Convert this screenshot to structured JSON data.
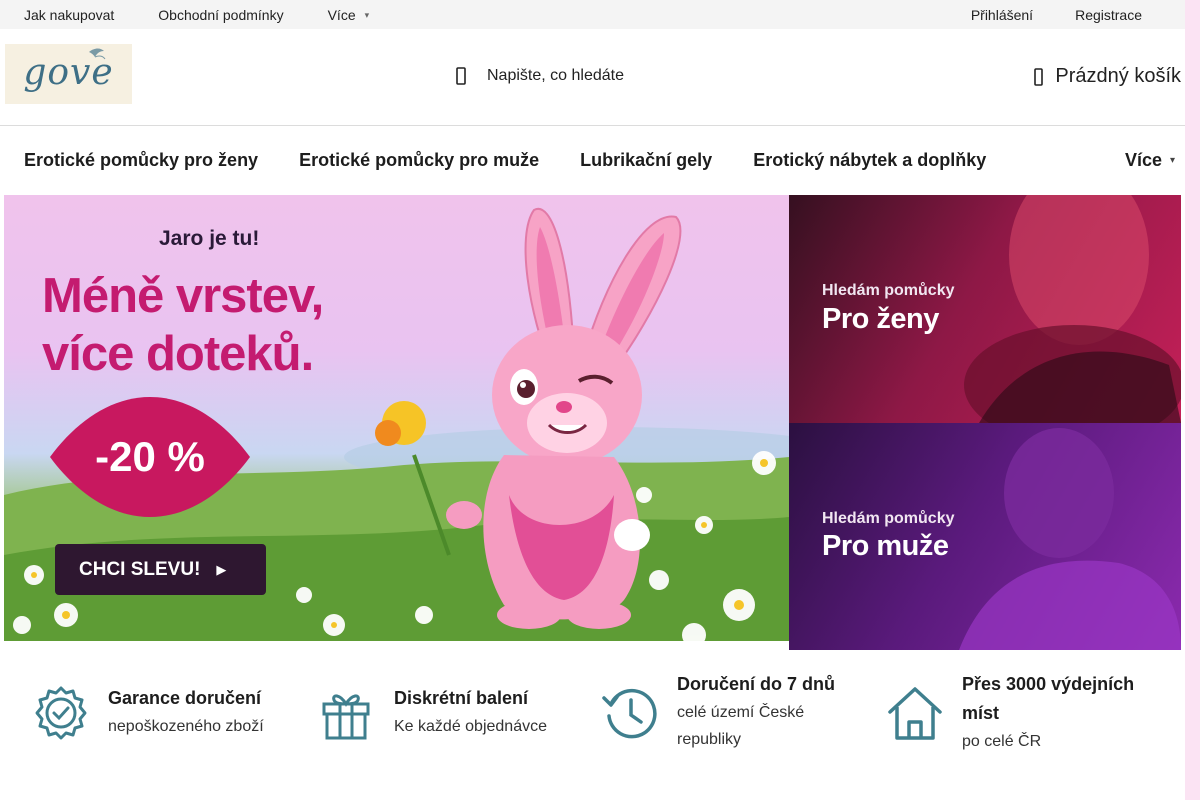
{
  "topbar": {
    "links": [
      "Jak nakupovat",
      "Obchodní podmínky"
    ],
    "more": "Více",
    "login": "Přihlášení",
    "register": "Registrace"
  },
  "header": {
    "logo": "gove",
    "search_placeholder": "Napište, co hledáte",
    "cart_label": "Prázdný košík"
  },
  "nav": {
    "items": [
      "Erotické pomůcky pro ženy",
      "Erotické pomůcky pro muže",
      "Lubrikační gely",
      "Erotický nábytek a doplňky"
    ],
    "more": "Více"
  },
  "hero": {
    "kicker": "Jaro je tu!",
    "title_line1": "Méně vrstev,",
    "title_line2": "více doteků.",
    "badge": "-20 %",
    "cta": "CHCI SLEVU!"
  },
  "promos": [
    {
      "sub": "Hledám pomůcky",
      "big": "Pro ženy"
    },
    {
      "sub": "Hledám pomůcky",
      "big": "Pro muže"
    }
  ],
  "features": [
    {
      "icon": "badge-check-icon",
      "title": "Garance doručení",
      "desc": "nepoškozeného zboží"
    },
    {
      "icon": "gift-icon",
      "title": "Diskrétní balení",
      "desc": "Ke každé objednávce"
    },
    {
      "icon": "clock-history-icon",
      "title": "Doručení do 7 dnů",
      "desc": "celé území České republiky"
    },
    {
      "icon": "house-icon",
      "title": "Přes 3000 výdejních míst",
      "desc": "po celé ČR"
    }
  ],
  "colors": {
    "accent_pink": "#c41b70",
    "icon_teal": "#3f7f8e",
    "background_side": "#fbe3f3"
  }
}
